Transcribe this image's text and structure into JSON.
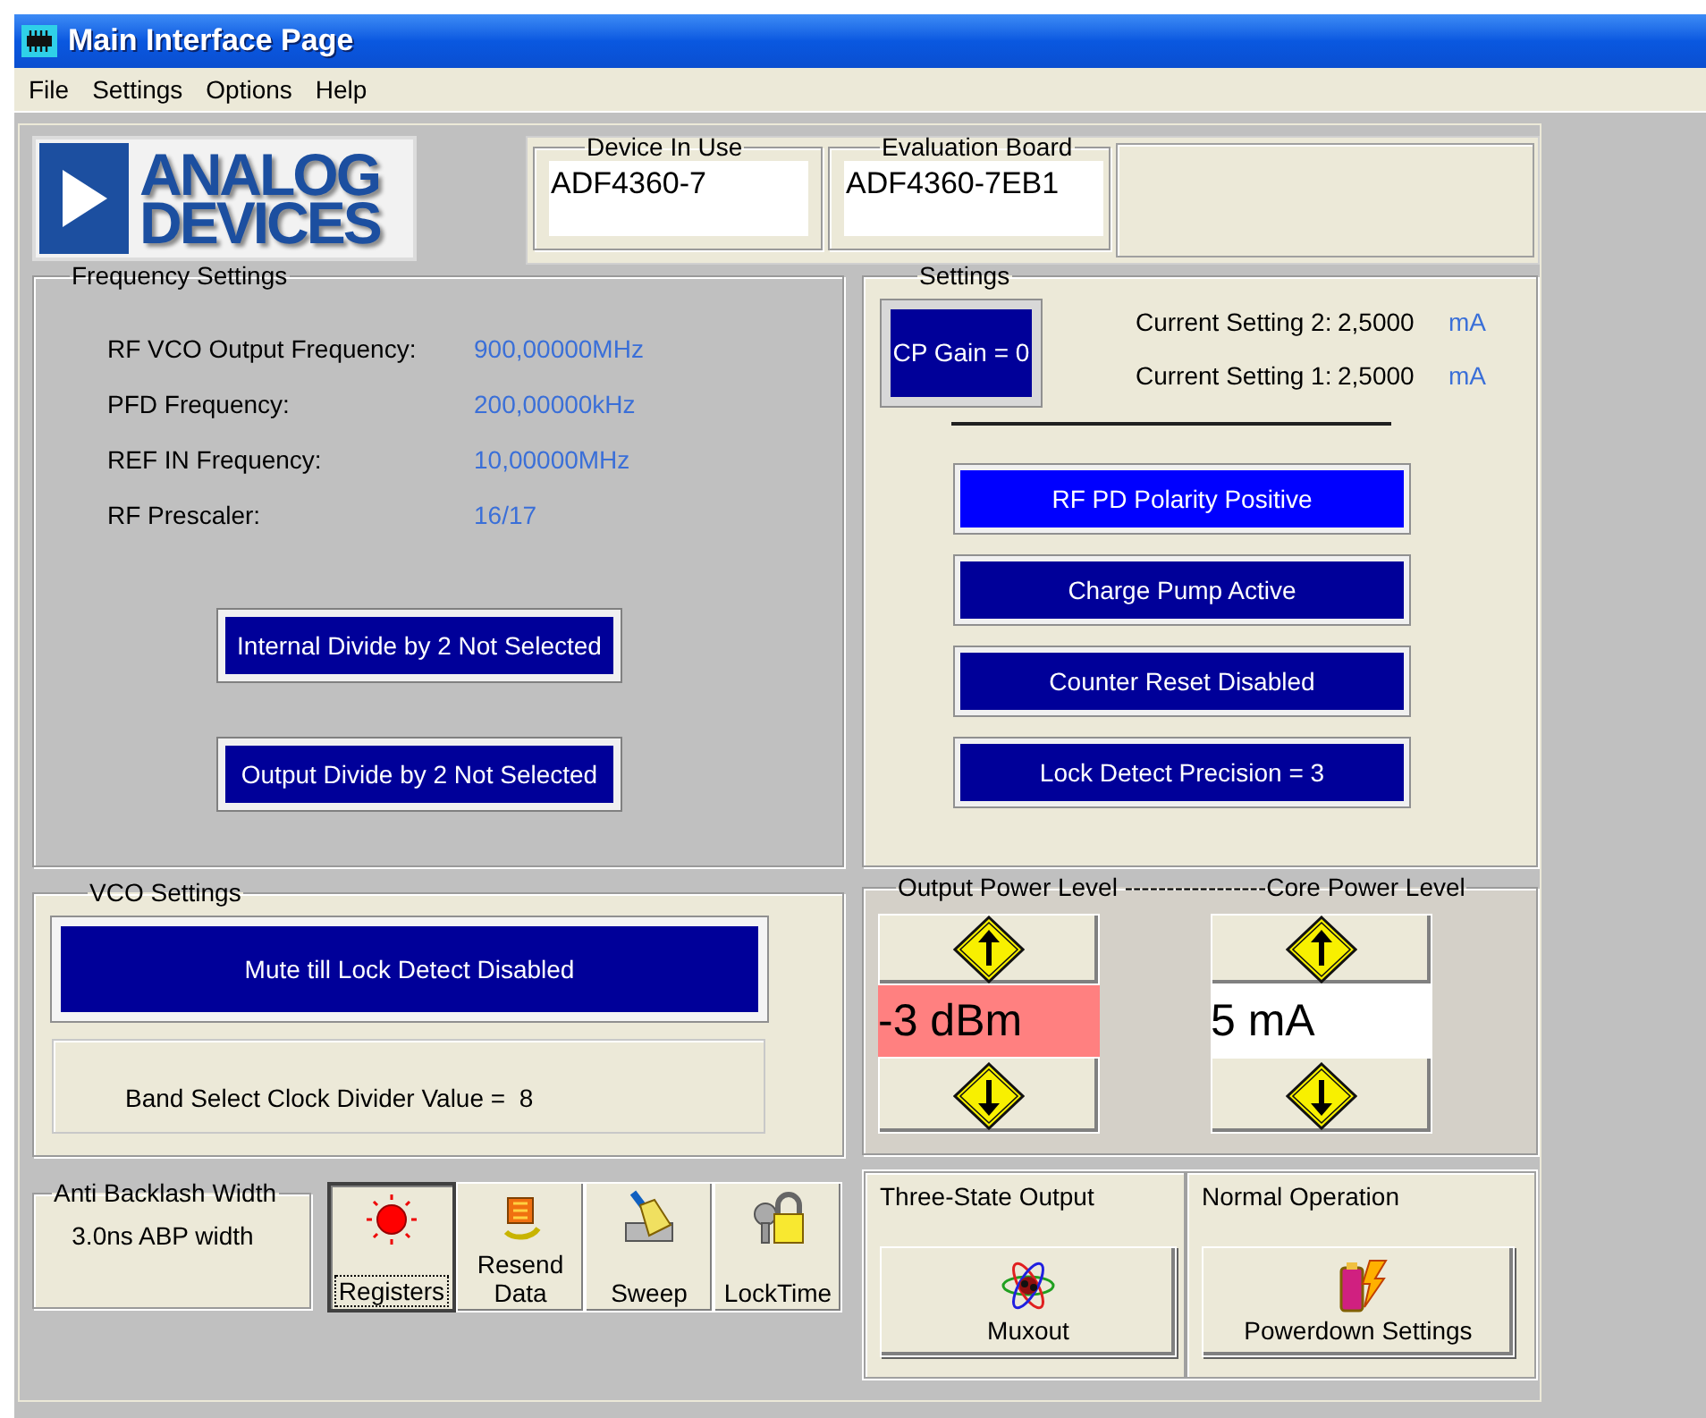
{
  "window": {
    "title": "Main Interface Page"
  },
  "menu": [
    "File",
    "Settings",
    "Options",
    "Help"
  ],
  "logo": {
    "lines": [
      "ANALOG",
      "DEVICES"
    ]
  },
  "device_in_use": {
    "label": "Device In Use",
    "value": "ADF4360-7"
  },
  "evaluation_board": {
    "label": "Evaluation Board",
    "value": "ADF4360-7EB1"
  },
  "frequency_settings": {
    "title": "Frequency Settings",
    "rows": [
      {
        "label": "RF VCO Output Frequency:",
        "value": "900,00000MHz"
      },
      {
        "label": "PFD Frequency:",
        "value": "200,00000kHz"
      },
      {
        "label": "REF IN Frequency:",
        "value": "10,00000MHz"
      },
      {
        "label": "RF Prescaler:",
        "value": "16/17"
      }
    ],
    "buttons": [
      "Internal Divide by 2 Not Selected",
      "Output Divide by 2 Not Selected"
    ]
  },
  "settings": {
    "title": "Settings",
    "cp_gain": "CP Gain = 0",
    "currents": [
      {
        "label": "Current Setting 2:",
        "value": "2,5000",
        "unit": "mA"
      },
      {
        "label": "Current Setting 1:",
        "value": "2,5000",
        "unit": "mA"
      }
    ],
    "buttons": [
      {
        "label": "RF PD Polarity Positive",
        "highlighted": true
      },
      {
        "label": "Charge Pump Active",
        "highlighted": false
      },
      {
        "label": "Counter Reset Disabled",
        "highlighted": false
      },
      {
        "label": "Lock Detect Precision = 3",
        "highlighted": false
      }
    ]
  },
  "vco_settings": {
    "title": "VCO Settings",
    "mute_button": "Mute till Lock Detect Disabled",
    "band_select": "Band Select Clock Divider Value =  8"
  },
  "power_levels": {
    "title": "Output Power Level -----------------Core Power Level",
    "levels": [
      {
        "value": "-3 dBm",
        "color": "#ff8080"
      },
      {
        "value": "5 mA",
        "color": "#ffffff"
      }
    ]
  },
  "anti_backlash": {
    "title": "Anti Backlash Width",
    "value": "3.0ns ABP width"
  },
  "toolbar": [
    {
      "label": "Registers",
      "kind": "registers",
      "selected": true
    },
    {
      "label": "Resend Data",
      "kind": "resend",
      "selected": false
    },
    {
      "label": "Sweep",
      "kind": "sweep",
      "selected": false
    },
    {
      "label": "LockTime",
      "kind": "locktime",
      "selected": false
    }
  ],
  "muxout": {
    "title": "Three-State Output",
    "button": "Muxout"
  },
  "powerdown": {
    "title": "Normal Operation",
    "button": "Powerdown Settings"
  }
}
